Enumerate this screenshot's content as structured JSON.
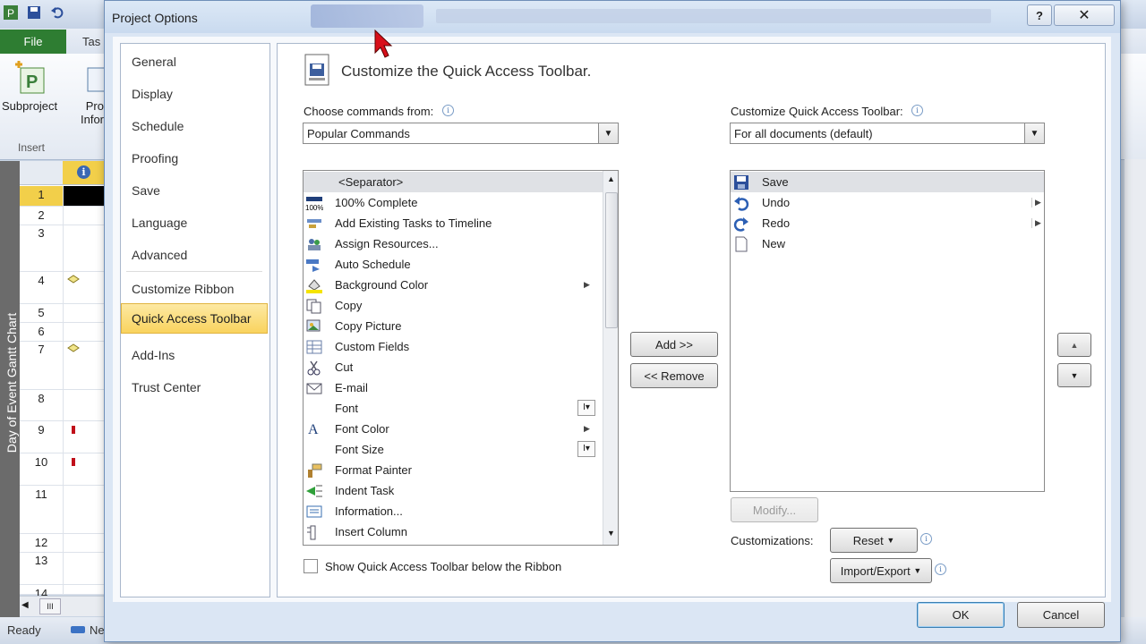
{
  "app": {
    "file_tab": "File",
    "task_tab": "Tas",
    "subproject_label": "Subproject",
    "project_info_label_1": "Pro",
    "project_info_label_2": "Infor",
    "insert_group": "Insert",
    "gantt_label": "Day of Event Gantt Chart",
    "rows": [
      "1",
      "2",
      "3",
      "4",
      "5",
      "6",
      "7",
      "8",
      "9",
      "10",
      "11",
      "12",
      "13",
      "14"
    ],
    "status_ready": "Ready",
    "status_new": "Ne"
  },
  "dialog": {
    "title": "Project Options",
    "help": "?",
    "close": "✕",
    "nav": [
      {
        "label": "General"
      },
      {
        "label": "Display"
      },
      {
        "label": "Schedule"
      },
      {
        "label": "Proofing"
      },
      {
        "label": "Save"
      },
      {
        "label": "Language"
      },
      {
        "label": "Advanced"
      },
      {
        "label": "Customize Ribbon"
      },
      {
        "label": "Quick Access Toolbar",
        "active": true
      },
      {
        "label": "Add-Ins"
      },
      {
        "label": "Trust Center"
      }
    ],
    "heading": "Customize the Quick Access Toolbar.",
    "choose_label": "Choose commands from:",
    "choose_value": "Popular Commands",
    "customize_label": "Customize Quick Access Toolbar:",
    "customize_value": "For all documents (default)",
    "commands": [
      {
        "label": "<Separator>",
        "icon": "separator",
        "selected": true
      },
      {
        "label": "100% Complete",
        "icon": "percent-complete-icon"
      },
      {
        "label": "Add Existing Tasks to Timeline",
        "icon": "timeline-icon"
      },
      {
        "label": "Assign Resources...",
        "icon": "resources-icon"
      },
      {
        "label": "Auto Schedule",
        "icon": "auto-schedule-icon"
      },
      {
        "label": "Background Color",
        "icon": "background-color-icon",
        "submenu": true
      },
      {
        "label": "Copy",
        "icon": "copy-icon"
      },
      {
        "label": "Copy Picture",
        "icon": "copy-picture-icon"
      },
      {
        "label": "Custom Fields",
        "icon": "custom-fields-icon"
      },
      {
        "label": "Cut",
        "icon": "cut-icon"
      },
      {
        "label": "E-mail",
        "icon": "email-icon"
      },
      {
        "label": "Font",
        "icon": "none",
        "combo": true
      },
      {
        "label": "Font Color",
        "icon": "font-color-icon",
        "submenu": true
      },
      {
        "label": "Font Size",
        "icon": "none",
        "combo": true
      },
      {
        "label": "Format Painter",
        "icon": "format-painter-icon"
      },
      {
        "label": "Indent Task",
        "icon": "indent-icon"
      },
      {
        "label": "Information...",
        "icon": "information-icon"
      },
      {
        "label": "Insert Column",
        "icon": "insert-column-icon"
      }
    ],
    "toolbar_items": [
      {
        "label": "Save",
        "icon": "save-icon",
        "selected": true
      },
      {
        "label": "Undo",
        "icon": "undo-icon",
        "submenu": true
      },
      {
        "label": "Redo",
        "icon": "redo-icon",
        "submenu": true
      },
      {
        "label": "New",
        "icon": "new-document-icon"
      }
    ],
    "add_button": "Add >>",
    "remove_button": "<< Remove",
    "modify_button": "Modify...",
    "customizations_label": "Customizations:",
    "reset_button": "Reset",
    "import_export_button": "Import/Export",
    "show_below_label": "Show Quick Access Toolbar below the Ribbon",
    "ok_button": "OK",
    "cancel_button": "Cancel"
  },
  "colors": {
    "accent": "#f9d35e",
    "file_tab": "#2e7d32",
    "selected_row": "#dfe1e5"
  }
}
